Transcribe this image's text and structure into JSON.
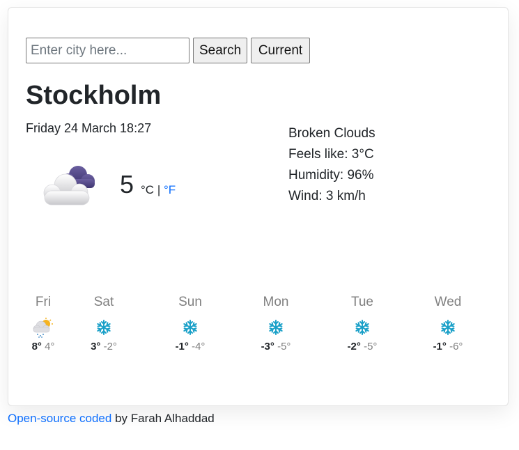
{
  "search": {
    "placeholder": "Enter city here...",
    "value": ""
  },
  "buttons": {
    "search": "Search",
    "current": "Current"
  },
  "city": "Stockholm",
  "datetime": "Friday 24 March 18:27",
  "current": {
    "icon": "broken-clouds-icon",
    "temperature": "5",
    "unit_celsius": "°C",
    "separator": "|",
    "unit_fahrenheit": "°F",
    "description": "Broken Clouds",
    "feels_like": "Feels like: 3°C",
    "humidity": "Humidity: 96%",
    "wind": "Wind: 3 km/h"
  },
  "forecast": [
    {
      "day": "Fri",
      "icon": "sun-cloud-rain-icon",
      "max": "8°",
      "min": "4°"
    },
    {
      "day": "Sat",
      "icon": "snowflake-icon",
      "max": "3°",
      "min": "-2°"
    },
    {
      "day": "Sun",
      "icon": "snowflake-icon",
      "max": "-1°",
      "min": "-4°"
    },
    {
      "day": "Mon",
      "icon": "snowflake-icon",
      "max": "-3°",
      "min": "-5°"
    },
    {
      "day": "Tue",
      "icon": "snowflake-icon",
      "max": "-2°",
      "min": "-5°"
    },
    {
      "day": "Wed",
      "icon": "snowflake-icon",
      "max": "-1°",
      "min": "-6°"
    }
  ],
  "footer": {
    "link_text": "Open-source coded",
    "author_text": " by Farah Alhaddad"
  },
  "colors": {
    "link": "#0d6efd",
    "muted": "#808080",
    "snow": "#1aa0c8",
    "cloud_dark": "#5b4f8c"
  }
}
